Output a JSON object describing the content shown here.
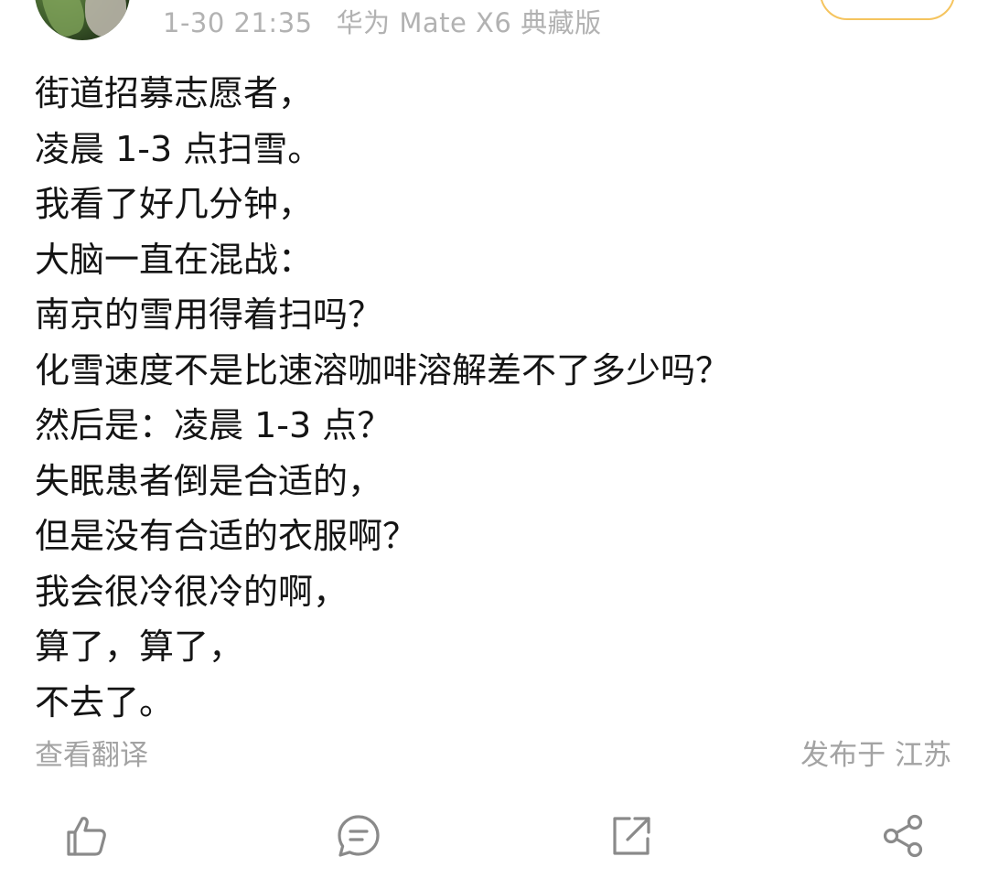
{
  "header": {
    "timestamp": "1-30 21:35",
    "device": "华为 Mate X6 典藏版"
  },
  "post": {
    "lines": [
      "街道招募志愿者，",
      "凌晨 1-3 点扫雪。",
      "我看了好几分钟，",
      "大脑一直在混战：",
      "南京的雪用得着扫吗？",
      "化雪速度不是比速溶咖啡溶解差不了多少吗？",
      "然后是：凌晨 1-3 点？",
      "失眠患者倒是合适的，",
      "但是没有合适的衣服啊？",
      "我会很冷很冷的啊，",
      "算了，算了，",
      "不去了。"
    ]
  },
  "footer": {
    "translate_label": "查看翻译",
    "location_label": "发布于 江苏"
  },
  "actions": {
    "icons": [
      "like-icon",
      "comment-icon",
      "repost-icon",
      "share-icon"
    ]
  },
  "colors": {
    "text": "#141414",
    "secondary": "#a3a3a3",
    "icon": "#8a8a8a",
    "follow_border": "#f5c45e"
  }
}
